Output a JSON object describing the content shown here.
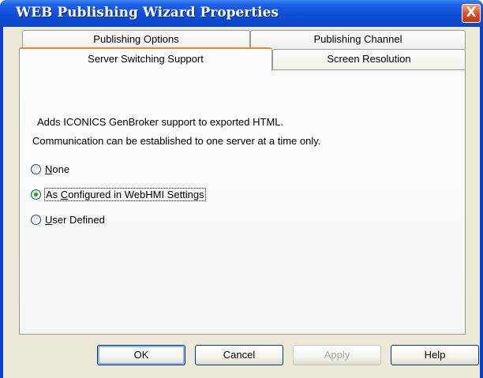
{
  "window": {
    "title": "WEB Publishing Wizard Properties",
    "close_label": "X"
  },
  "tabs": {
    "row1": [
      "Publishing Options",
      "Publishing Channel"
    ],
    "row2": [
      "Server Switching Support",
      "Screen Resolution"
    ],
    "active": "Server Switching Support"
  },
  "panel": {
    "description_line1": "Adds ICONICS GenBroker support to exported HTML.",
    "description_line2": "Communication can be established to one server at a time only.",
    "options": [
      {
        "label": "None",
        "accel": "N",
        "selected": false
      },
      {
        "label": "As Configured in WebHMI Settings",
        "accel": "C",
        "selected": true
      },
      {
        "label": "User Defined",
        "accel": "U",
        "selected": false
      }
    ]
  },
  "buttons": {
    "ok": "OK",
    "cancel": "Cancel",
    "apply": "Apply",
    "help": "Help"
  },
  "colors": {
    "titlebar": "#0a45c8",
    "active_tab_accent": "#e68b2c",
    "radio_dot": "#21a121"
  }
}
